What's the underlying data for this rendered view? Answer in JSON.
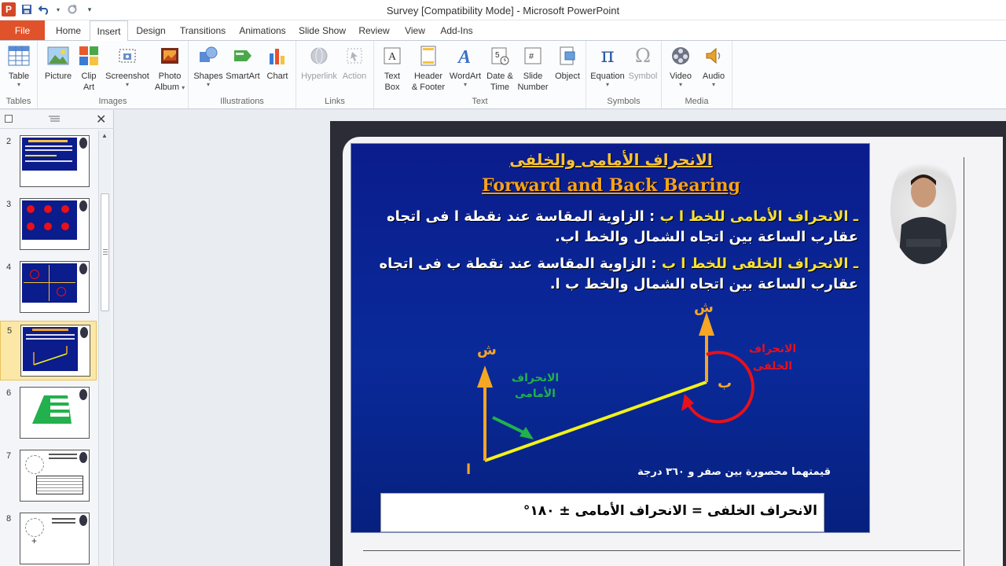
{
  "window": {
    "title": "Survey [Compatibility Mode]  -  Microsoft PowerPoint"
  },
  "tabs": [
    {
      "label": "File",
      "active": false
    },
    {
      "label": "Home",
      "active": false
    },
    {
      "label": "Insert",
      "active": true
    },
    {
      "label": "Design",
      "active": false
    },
    {
      "label": "Transitions",
      "active": false
    },
    {
      "label": "Animations",
      "active": false
    },
    {
      "label": "Slide Show",
      "active": false
    },
    {
      "label": "Review",
      "active": false
    },
    {
      "label": "View",
      "active": false
    },
    {
      "label": "Add-Ins",
      "active": false
    }
  ],
  "ribbon": {
    "groups": {
      "tables": "Tables",
      "images": "Images",
      "illustrations": "Illustrations",
      "links": "Links",
      "text": "Text",
      "symbols": "Symbols",
      "media": "Media"
    },
    "buttons": {
      "table": "Table",
      "picture": "Picture",
      "clip_art_1": "Clip",
      "clip_art_2": "Art",
      "screenshot": "Screenshot",
      "photo_album_1": "Photo",
      "photo_album_2": "Album",
      "shapes": "Shapes",
      "smartart": "SmartArt",
      "chart": "Chart",
      "hyperlink": "Hyperlink",
      "action": "Action",
      "text_box_1": "Text",
      "text_box_2": "Box",
      "header_footer_1": "Header",
      "header_footer_2": "& Footer",
      "wordart": "WordArt",
      "date_time_1": "Date &",
      "date_time_2": "Time",
      "slide_number_1": "Slide",
      "slide_number_2": "Number",
      "object": "Object",
      "equation": "Equation",
      "symbol": "Symbol",
      "video": "Video",
      "audio": "Audio"
    }
  },
  "thumbnails": [
    {
      "number": "2",
      "selected": false
    },
    {
      "number": "3",
      "selected": false
    },
    {
      "number": "4",
      "selected": false
    },
    {
      "number": "5",
      "selected": true
    },
    {
      "number": "6",
      "selected": false
    },
    {
      "number": "7",
      "selected": false
    },
    {
      "number": "8",
      "selected": false
    }
  ],
  "slide": {
    "title_ar": "الانحراف الأمامى والخلفى",
    "title_en": "Forward and Back Bearing",
    "bullet1_lead": "ـ الانحراف الأمامى للخط ا ب",
    "bullet1_rest": " : الزاوية المقاسة عند نقطة  ا فى اتجاه عقارب الساعة بين اتجاه الشمال والخط اب.",
    "bullet2_lead": "ـ الانحراف الخلفى للخط ا ب",
    "bullet2_rest": " : الزاوية المقاسة عند نقطة ب فى اتجاه عقارب الساعة بين اتجاه الشمال والخط ب ا.",
    "north_a": "ش",
    "north_b": "ش",
    "point_a": "ا",
    "point_b": "ب",
    "forward_label_1": "الانحراف",
    "forward_label_2": "الأمامى",
    "back_label_1": "الانحراف",
    "back_label_2": "الخلفى",
    "range_note": "قيمتهما  محصورة بين صفر و  ٣٦٠ درجة",
    "formula": "الانحراف الخلفى = الانحراف الأمامى ± ١٨٠°"
  },
  "colors": {
    "file_tab": "#e0522a",
    "slide_blue": "#0b1c8c",
    "highlight_yellow": "#f7e234",
    "title_orange": "#f7a21a",
    "arrow_orange": "#f5a623",
    "line_yellow": "#f2f21a",
    "back_red": "#e8101a",
    "forward_green": "#22b14c",
    "selected_thumb": "#fce8a6"
  }
}
